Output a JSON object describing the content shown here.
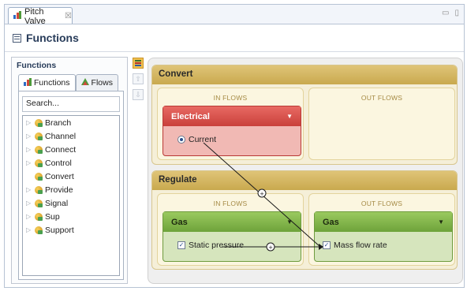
{
  "editor_tab": {
    "title": "Pitch Valve",
    "close": "☒"
  },
  "window_buttons": {
    "minimize": "▭",
    "maximize": "▯"
  },
  "page": {
    "title": "Functions"
  },
  "palette": {
    "title": "Functions",
    "tabs": [
      {
        "label": "Functions"
      },
      {
        "label": "Flows"
      }
    ],
    "search_placeholder": "Search...",
    "items": [
      {
        "label": "Branch",
        "expandable": true
      },
      {
        "label": "Channel",
        "expandable": true
      },
      {
        "label": "Connect",
        "expandable": true
      },
      {
        "label": "Control",
        "expandable": true
      },
      {
        "label": "Convert",
        "expandable": false
      },
      {
        "label": "Provide",
        "expandable": true
      },
      {
        "label": "Signal",
        "expandable": true
      },
      {
        "label": "Sup",
        "expandable": true
      },
      {
        "label": "Support",
        "expandable": true
      }
    ]
  },
  "diagram": {
    "functions": [
      {
        "name": "Convert",
        "in_label": "IN FLOWS",
        "out_label": "OUT FLOWS",
        "in_flow": {
          "name": "Electrical",
          "item": "Current"
        }
      },
      {
        "name": "Regulate",
        "in_label": "IN FLOWS",
        "out_label": "OUT FLOWS",
        "in_flow": {
          "name": "Gas",
          "item": "Static pressure"
        },
        "out_flow": {
          "name": "Gas",
          "item": "Mass flow rate"
        }
      }
    ]
  }
}
